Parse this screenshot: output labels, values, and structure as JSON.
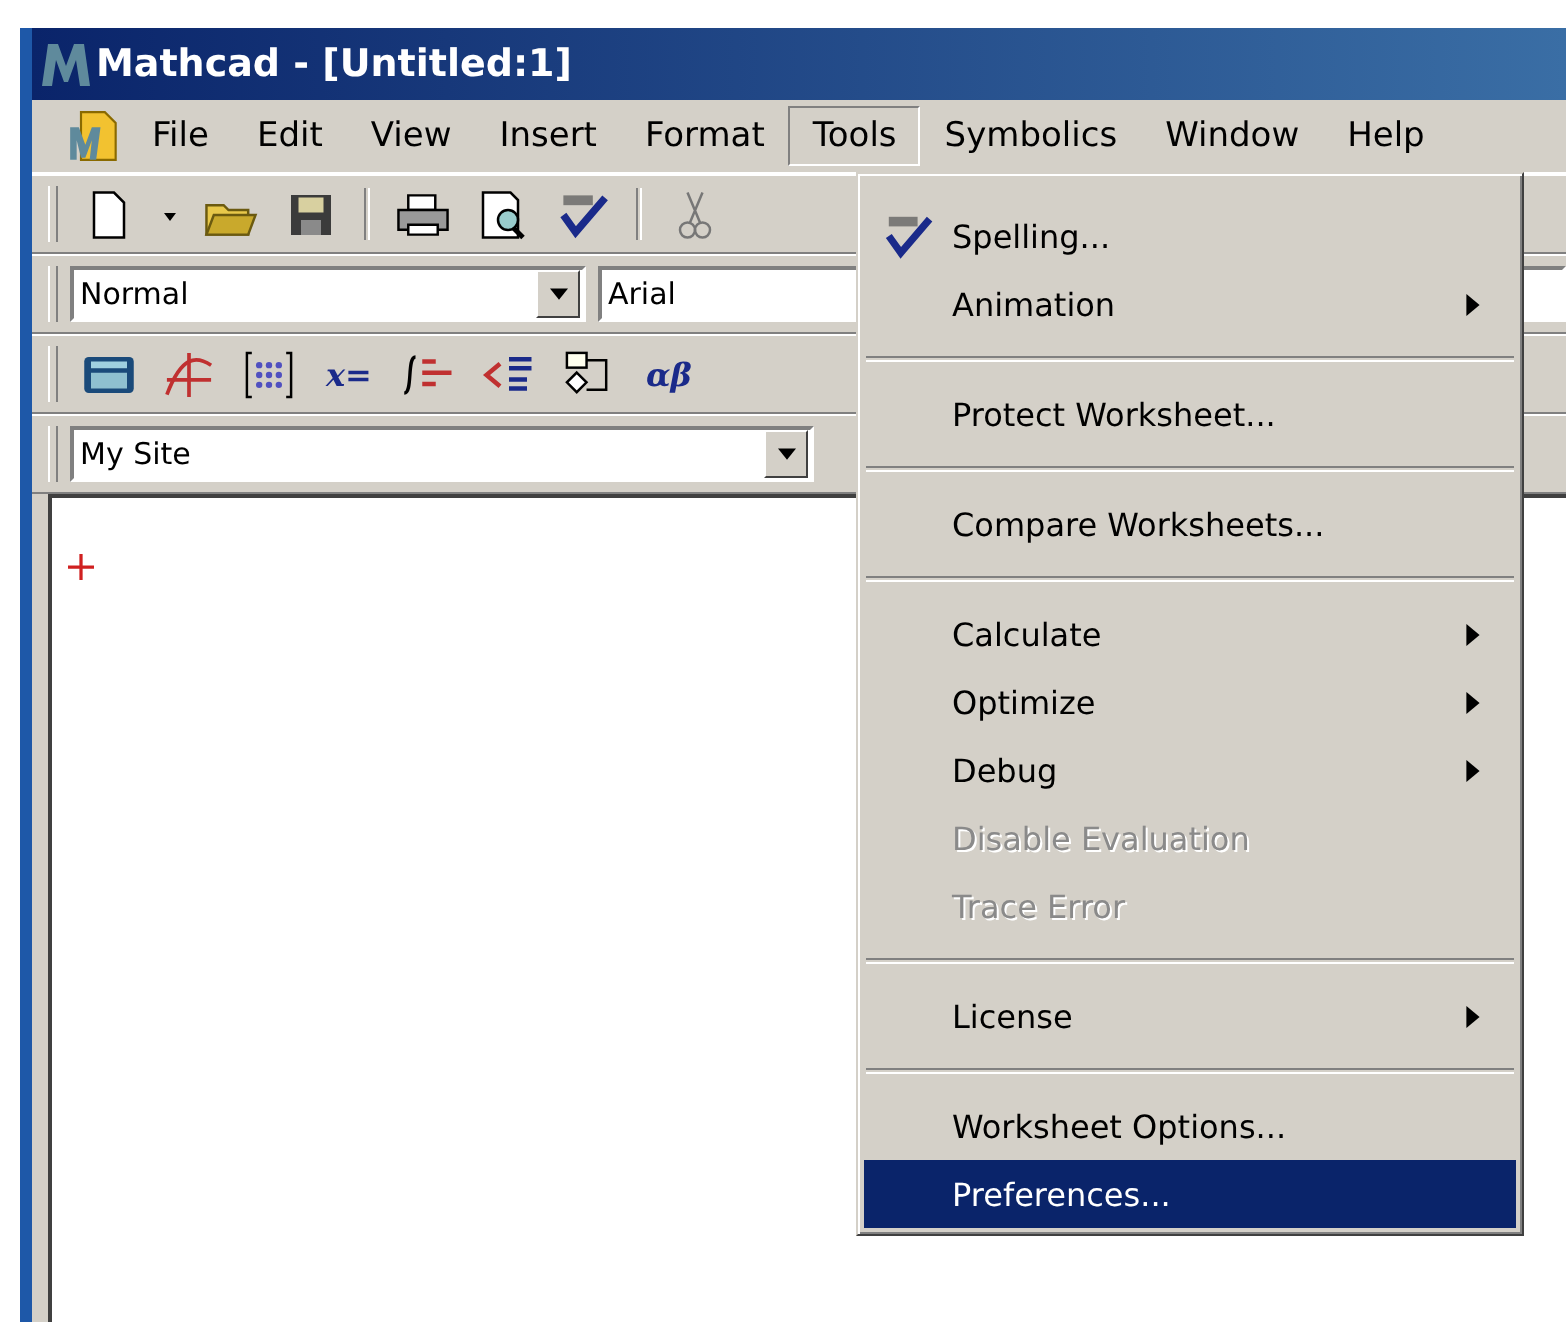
{
  "window": {
    "title": "Mathcad - [Untitled:1]"
  },
  "menu_bar": [
    {
      "label": "File",
      "selected": false
    },
    {
      "label": "Edit",
      "selected": false
    },
    {
      "label": "View",
      "selected": false
    },
    {
      "label": "Insert",
      "selected": false
    },
    {
      "label": "Format",
      "selected": false
    },
    {
      "label": "Tools",
      "selected": true
    },
    {
      "label": "Symbolics",
      "selected": false
    },
    {
      "label": "Window",
      "selected": false
    },
    {
      "label": "Help",
      "selected": false
    }
  ],
  "standard_toolbar": [
    {
      "kind": "new"
    },
    {
      "kind": "caret"
    },
    {
      "kind": "open"
    },
    {
      "kind": "save"
    },
    {
      "kind": "separator"
    },
    {
      "kind": "print"
    },
    {
      "kind": "preview"
    },
    {
      "kind": "spell"
    },
    {
      "kind": "separator"
    },
    {
      "kind": "cut"
    }
  ],
  "formatting_toolbar": {
    "style": "Normal",
    "font": "Arial"
  },
  "math_toolbar": [
    {
      "kind": "calculator"
    },
    {
      "kind": "graph"
    },
    {
      "kind": "matrix"
    },
    {
      "kind": "glyph",
      "text": "x="
    },
    {
      "kind": "calculus"
    },
    {
      "kind": "boolean"
    },
    {
      "kind": "programming"
    },
    {
      "kind": "glyph",
      "text": "αβ"
    }
  ],
  "resources_toolbar": {
    "value": "My Site"
  },
  "tools_menu": [
    {
      "kind": "spellitem",
      "label": "Spelling...",
      "submenu": false,
      "disabled": false,
      "selected": false
    },
    {
      "kind": "item",
      "label": "Animation",
      "submenu": true,
      "disabled": false,
      "selected": false
    },
    {
      "kind": "separator"
    },
    {
      "kind": "item",
      "label": "Protect Worksheet...",
      "submenu": false,
      "disabled": false,
      "selected": false
    },
    {
      "kind": "separator"
    },
    {
      "kind": "item",
      "label": "Compare Worksheets...",
      "submenu": false,
      "disabled": false,
      "selected": false
    },
    {
      "kind": "separator"
    },
    {
      "kind": "item",
      "label": "Calculate",
      "submenu": true,
      "disabled": false,
      "selected": false
    },
    {
      "kind": "item",
      "label": "Optimize",
      "submenu": true,
      "disabled": false,
      "selected": false
    },
    {
      "kind": "item",
      "label": "Debug",
      "submenu": true,
      "disabled": false,
      "selected": false
    },
    {
      "kind": "item",
      "label": "Disable Evaluation",
      "submenu": false,
      "disabled": true,
      "selected": false
    },
    {
      "kind": "item",
      "label": "Trace Error",
      "submenu": false,
      "disabled": true,
      "selected": false
    },
    {
      "kind": "separator"
    },
    {
      "kind": "item",
      "label": "License",
      "submenu": true,
      "disabled": false,
      "selected": false
    },
    {
      "kind": "separator"
    },
    {
      "kind": "item",
      "label": "Worksheet Options...",
      "submenu": false,
      "disabled": false,
      "selected": false
    },
    {
      "kind": "item",
      "label": "Preferences...",
      "submenu": false,
      "disabled": false,
      "selected": true
    }
  ]
}
